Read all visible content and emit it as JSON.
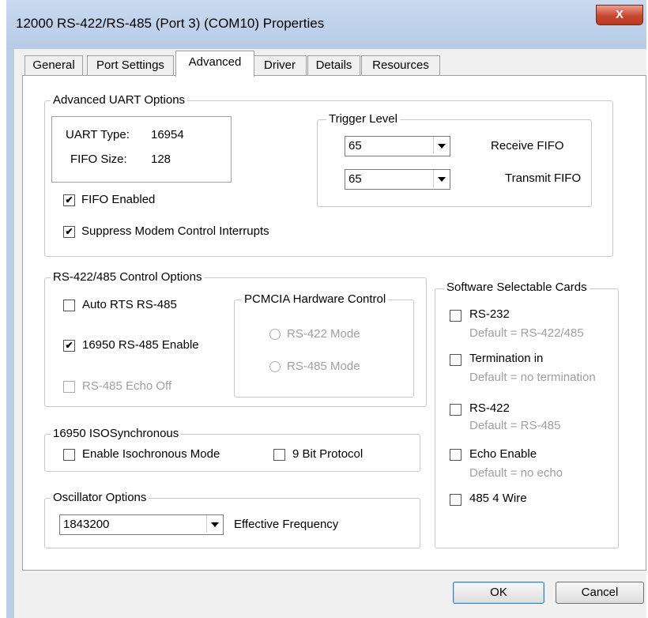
{
  "window": {
    "title": "12000 RS-422/RS-485 (Port 3) (COM10) Properties",
    "close_label": "X"
  },
  "tabs": [
    {
      "label": "General"
    },
    {
      "label": "Port Settings"
    },
    {
      "label": "Advanced",
      "active": true
    },
    {
      "label": "Driver"
    },
    {
      "label": "Details"
    },
    {
      "label": "Resources"
    }
  ],
  "uart": {
    "group_label": "Advanced UART Options",
    "type_label": "UART Type:",
    "type_value": "16954",
    "fifo_size_label": "FIFO Size:",
    "fifo_size_value": "128",
    "fifo_enabled": {
      "label": "FIFO Enabled",
      "checked": true
    },
    "suppress": {
      "label": "Suppress Modem Control Interrupts",
      "checked": true
    }
  },
  "trigger": {
    "group_label": "Trigger Level",
    "receive": {
      "value": "65",
      "label": "Receive FIFO"
    },
    "transmit": {
      "value": "65",
      "label": "Transmit FIFO"
    }
  },
  "rs_control": {
    "group_label": "RS-422/485 Control Options",
    "auto_rts": {
      "label": "Auto RTS RS-485",
      "checked": false
    },
    "enable_16950": {
      "label": "16950 RS-485 Enable",
      "checked": true
    },
    "echo_off": {
      "label": "RS-485 Echo Off",
      "checked": false,
      "disabled": true
    }
  },
  "pcmcia": {
    "group_label": "PCMCIA Hardware Control",
    "rs422_mode": "RS-422 Mode",
    "rs485_mode": "RS-485 Mode"
  },
  "iso": {
    "group_label": "16950 ISOSynchronous",
    "isochronous": {
      "label": "Enable Isochronous Mode",
      "checked": false
    },
    "nine_bit": {
      "label": "9 Bit Protocol",
      "checked": false
    }
  },
  "oscillator": {
    "group_label": "Oscillator Options",
    "value": "1843200",
    "label": "Effective Frequency"
  },
  "software": {
    "group_label": "Software Selectable Cards",
    "items": [
      {
        "label": "RS-232",
        "default": "Default = RS-422/485",
        "checked": false
      },
      {
        "label": "Termination in",
        "default": "Default = no termination",
        "checked": false
      },
      {
        "label": "RS-422",
        "default": "Default = RS-485",
        "checked": false
      },
      {
        "label": "Echo Enable",
        "default": "Default = no echo",
        "checked": false
      },
      {
        "label": "485 4 Wire",
        "default": "",
        "checked": false
      }
    ]
  },
  "buttons": {
    "ok": "OK",
    "cancel": "Cancel"
  },
  "checkmark": "✔"
}
